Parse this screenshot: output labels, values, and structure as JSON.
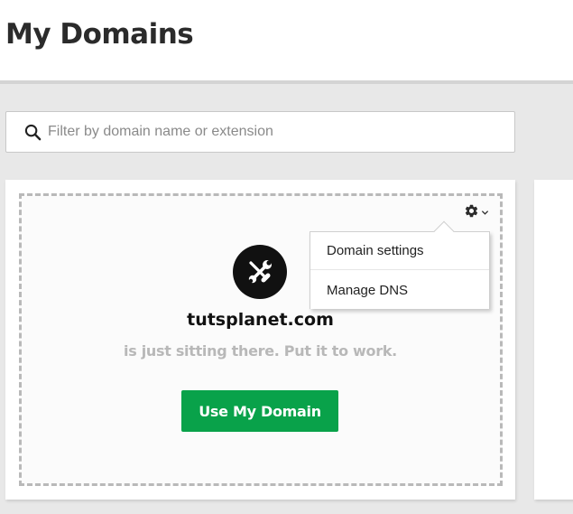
{
  "header": {
    "title": "My Domains"
  },
  "search": {
    "placeholder": "Filter by domain name or extension"
  },
  "domain_card": {
    "domain": "tutsplanet.com",
    "tagline": "is just sitting there. Put it to work.",
    "cta_label": "Use My Domain",
    "settings_menu": {
      "items": [
        {
          "label": "Domain settings"
        },
        {
          "label": "Manage DNS"
        }
      ]
    }
  },
  "icons": {
    "search": "search-icon",
    "settings": "gear-icon",
    "caret": "chevron-down-icon",
    "tools": "wrench-screwdriver-icon"
  },
  "colors": {
    "accent_green": "#09a24a",
    "badge_black": "#111111",
    "background": "#e8e8e8",
    "muted_text": "#b8b8b8"
  }
}
